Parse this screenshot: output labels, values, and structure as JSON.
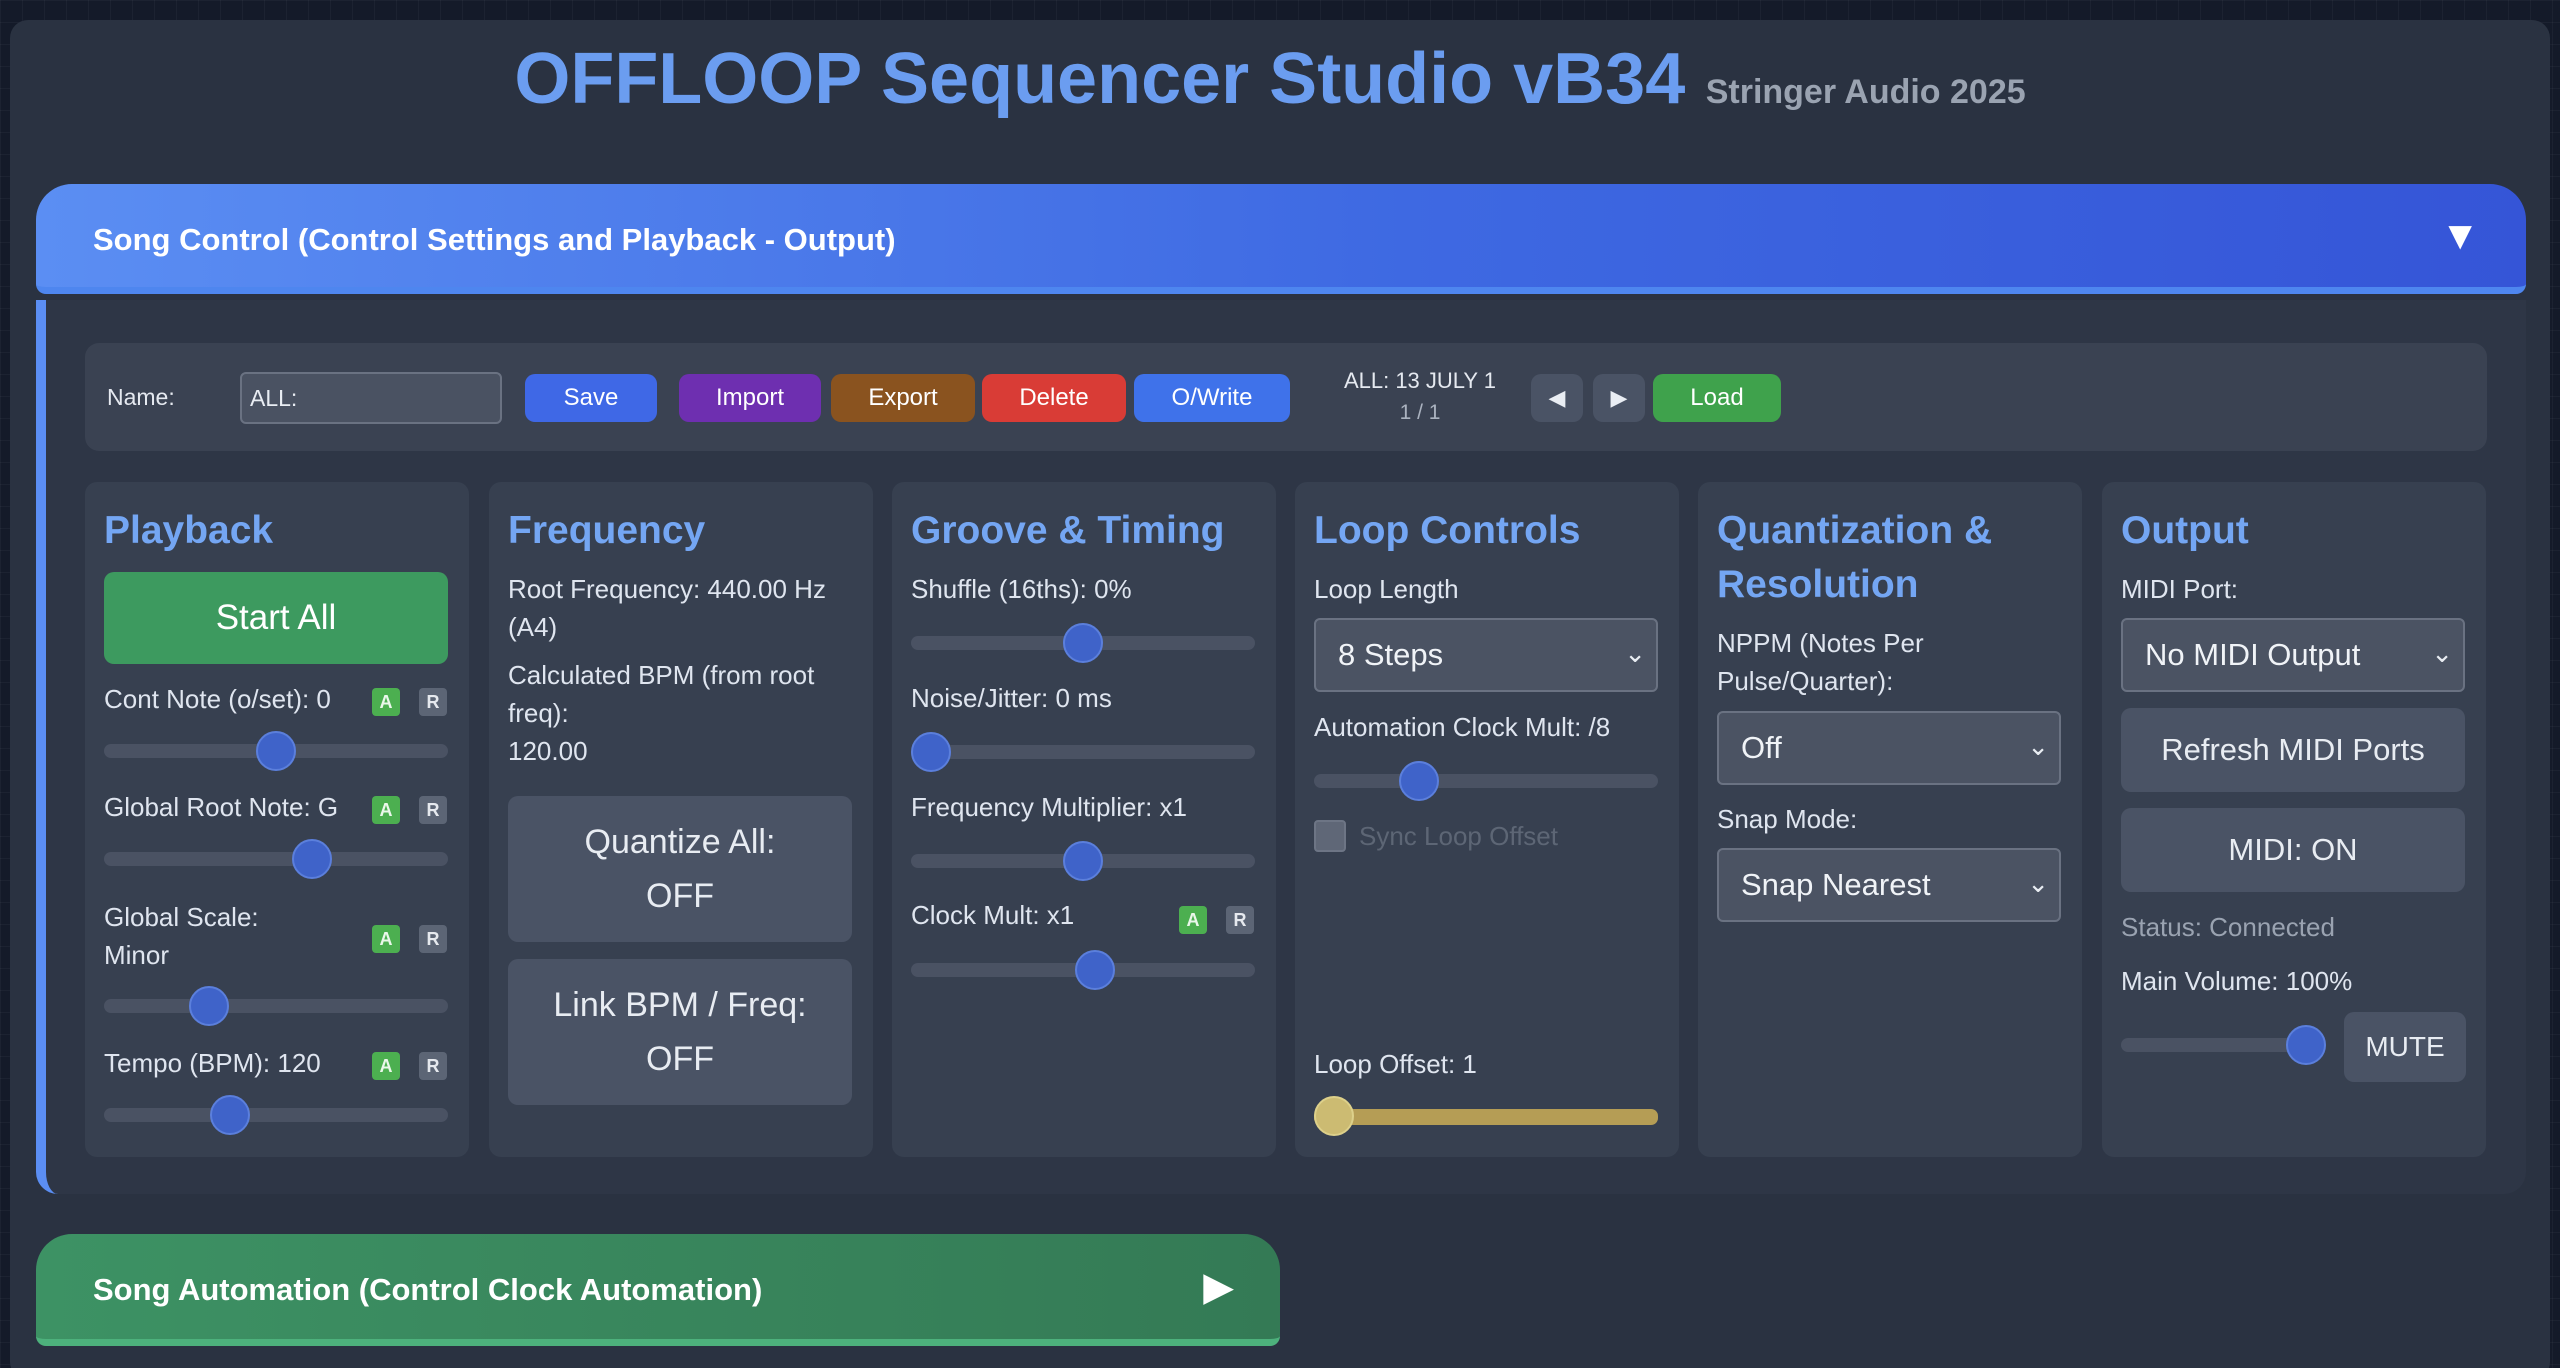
{
  "header": {
    "title": "OFFLOOP Sequencer Studio vB34",
    "subtitle": "Stringer Audio 2025"
  },
  "song_control": {
    "label": "Song Control (Control Settings and Playback - Output)",
    "arrow": "▼"
  },
  "toolbar": {
    "name_label": "Name:",
    "name_value": "ALL:",
    "buttons": {
      "save": "Save",
      "import": "Import",
      "export": "Export",
      "delete": "Delete",
      "owrite": "O/Write",
      "load": "Load"
    },
    "status_line": "ALL: 13 JULY 1",
    "page_indicator": "1 / 1",
    "prev_glyph": "◀",
    "next_glyph": "▶"
  },
  "playback": {
    "title": "Playback",
    "start_label": "Start All",
    "cont_note": {
      "label": "Cont Note (o/set): 0",
      "value": 0.5
    },
    "root_note": {
      "label": "Global Root Note: G",
      "value": 0.62
    },
    "scale": {
      "label_1": "Global Scale:",
      "label_2": "Minor",
      "value": 0.28
    },
    "tempo": {
      "label": "Tempo (BPM): 120",
      "value": 0.35
    },
    "badge_a": "A",
    "badge_r": "R"
  },
  "frequency": {
    "title": "Frequency",
    "root_1": "Root Frequency: 440.00 Hz",
    "root_2": "(A4)",
    "calc_1": "Calculated BPM (from root",
    "calc_2": "freq):",
    "calc_3": "120.00",
    "quantize_1": "Quantize All:",
    "quantize_2": "OFF",
    "link_1": "Link BPM / Freq:",
    "link_2": "OFF"
  },
  "groove": {
    "title": "Groove & Timing",
    "shuffle": {
      "label": "Shuffle (16ths): 0%",
      "value": 0.5
    },
    "noise": {
      "label": "Noise/Jitter: 0 ms",
      "value": 0.0
    },
    "freq_mult": {
      "label": "Frequency Multiplier: x1",
      "value": 0.5
    },
    "clock_mult": {
      "label": "Clock Mult: x1",
      "value": 0.54
    },
    "badge_a": "A",
    "badge_r": "R"
  },
  "loop": {
    "title": "Loop Controls",
    "length_label": "Loop Length",
    "length_value": "8 Steps",
    "automation_label": "Automation Clock Mult: /8",
    "automation_value": 0.28,
    "sync_label": "Sync Loop Offset",
    "offset_label": "Loop Offset: 1",
    "offset_value": 0.0
  },
  "quantization": {
    "title_1": "Quantization &",
    "title_2": "Resolution",
    "nppm_1": "NPPM (Notes Per",
    "nppm_2": "Pulse/Quarter):",
    "nppm_value": "Off",
    "snap_label": "Snap Mode:",
    "snap_value": "Snap Nearest"
  },
  "output": {
    "title": "Output",
    "midi_port_label": "MIDI Port:",
    "midi_port_value": "No MIDI Output",
    "refresh_label": "Refresh MIDI Ports",
    "midi_toggle": "MIDI: ON",
    "status": "Status: Connected",
    "volume_label": "Main Volume: 100%",
    "volume_value": 1.0,
    "mute_label": "MUTE"
  },
  "song_automation": {
    "label": "Song Automation (Control Clock Automation)",
    "arrow": "▶"
  },
  "colors": {
    "accent": "#6b9df0",
    "save": "#3f68e6",
    "import": "#6e2fb0",
    "export": "#8a531f",
    "delete": "#d93c36",
    "owrite": "#3f72ea",
    "load": "#3fa24c",
    "start": "#3d9a5f"
  }
}
